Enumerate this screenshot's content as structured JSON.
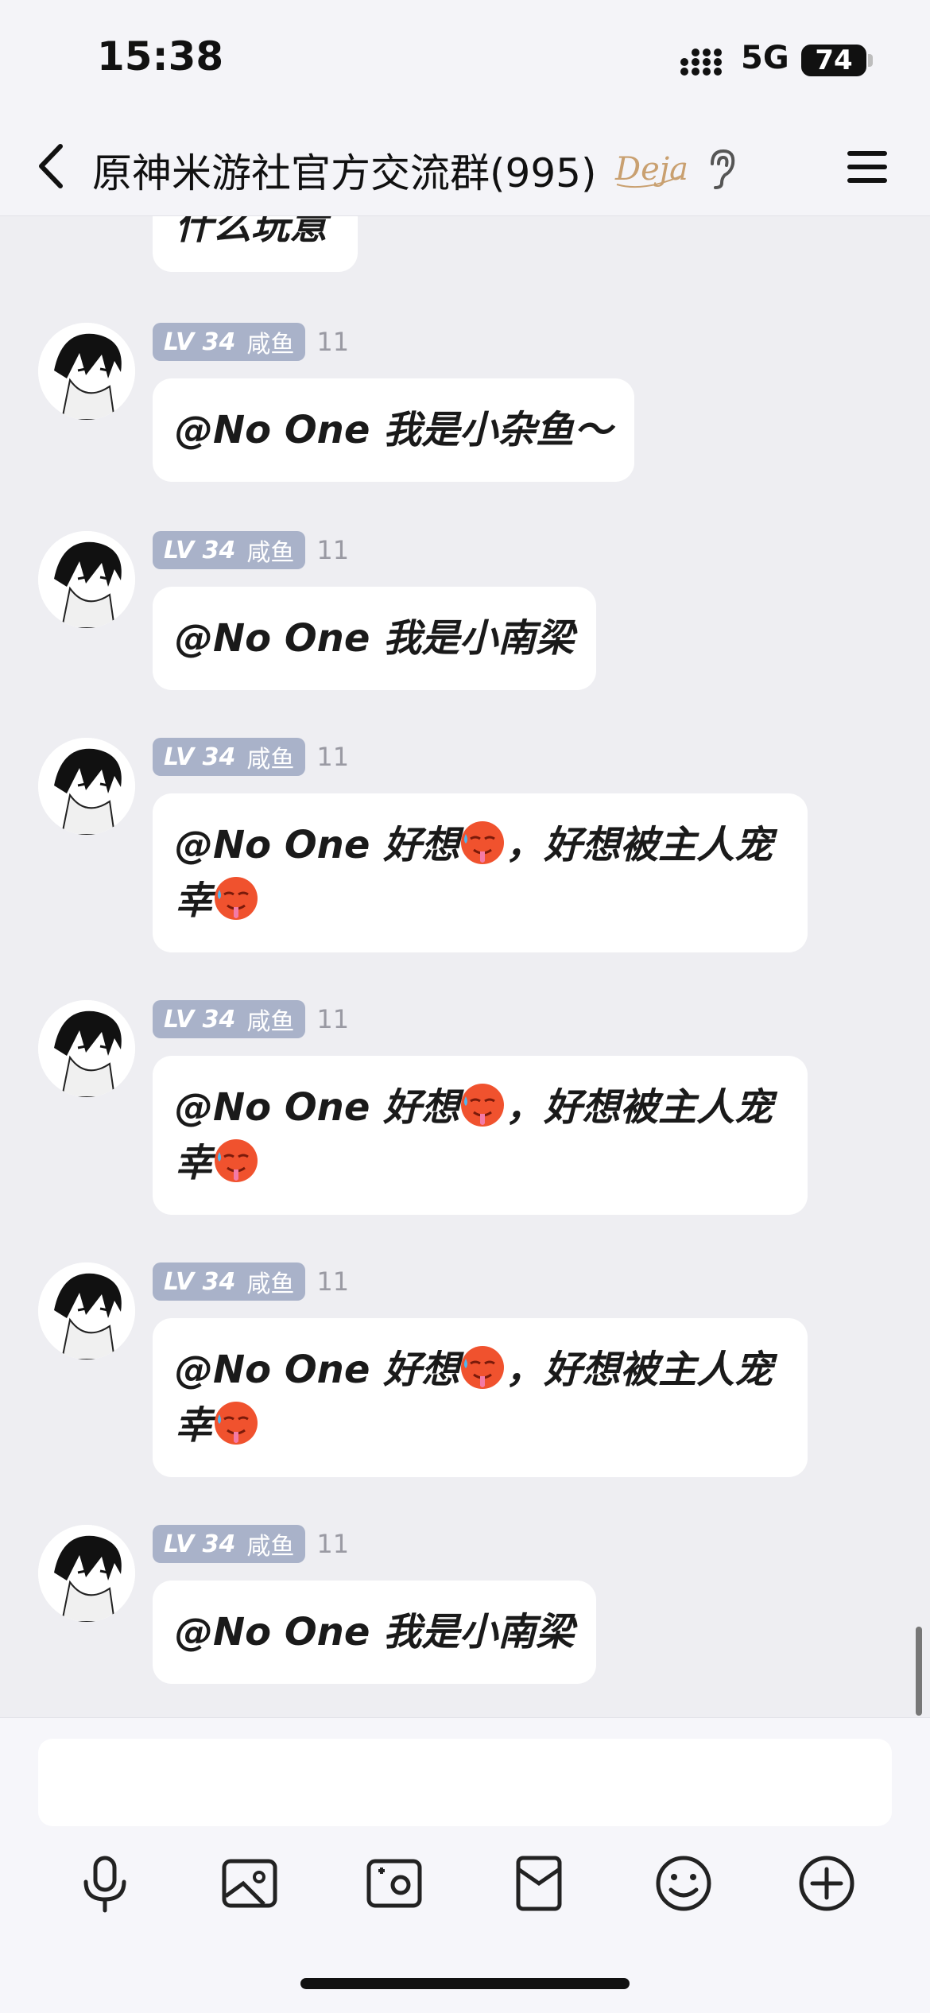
{
  "status_bar": {
    "time": "15:38",
    "network": "5G",
    "battery": "74"
  },
  "header": {
    "title": "原神米游社官方交流群(995)",
    "logo_text": "Deja"
  },
  "top_cut_message": "什么玩意",
  "messages": [
    {
      "level": "LV 34",
      "title": "咸鱼",
      "sender": "11",
      "mention": "@No One",
      "text": "我是小杂鱼～",
      "emoji": false
    },
    {
      "level": "LV 34",
      "title": "咸鱼",
      "sender": "11",
      "mention": "@No One",
      "text": "我是小南梁",
      "emoji": false
    },
    {
      "level": "LV 34",
      "title": "咸鱼",
      "sender": "11",
      "mention": "@No One",
      "text_a": "好想",
      "text_b": "，好想被主人宠",
      "text_c": "幸",
      "emoji": true
    },
    {
      "level": "LV 34",
      "title": "咸鱼",
      "sender": "11",
      "mention": "@No One",
      "text_a": "好想",
      "text_b": "，好想被主人宠",
      "text_c": "幸",
      "emoji": true
    },
    {
      "level": "LV 34",
      "title": "咸鱼",
      "sender": "11",
      "mention": "@No One",
      "text_a": "好想",
      "text_b": "，好想被主人宠",
      "text_c": "幸",
      "emoji": true
    },
    {
      "level": "LV 34",
      "title": "咸鱼",
      "sender": "11",
      "mention": "@No One",
      "text": "我是小南梁",
      "emoji": false
    }
  ],
  "input": {
    "placeholder": ""
  },
  "toolbar": [
    "microphone-icon",
    "photo-icon",
    "camera-icon",
    "red-packet-icon",
    "emoji-icon",
    "plus-icon"
  ],
  "colors": {
    "background": "#EEEEF2",
    "bubble": "#FFFFFF",
    "badge": "#A9B2C9"
  }
}
